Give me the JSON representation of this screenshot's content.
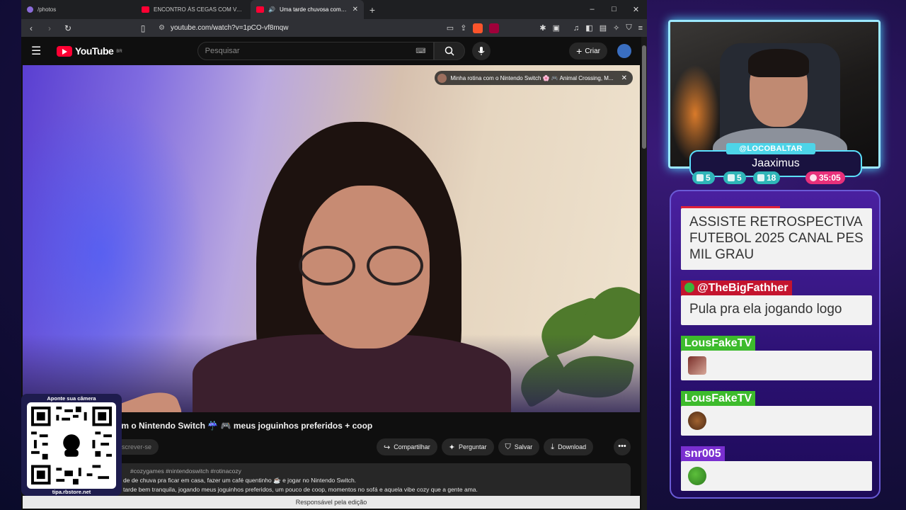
{
  "browser": {
    "tabs": [
      {
        "label": "/photos",
        "active": false
      },
      {
        "label": "ENCONTRO ÀS CEGAS COM VALENTINA BA",
        "active": false
      },
      {
        "label": "Uma tarde chuvosa com o Nintendo",
        "active": true
      }
    ],
    "url": "youtube.com/watch?v=1pCO-vf8mqw",
    "window_controls": [
      "–",
      "□",
      "✕"
    ],
    "brave_badge": "1"
  },
  "youtube": {
    "logo": "YouTube",
    "region": "BR",
    "search_placeholder": "Pesquisar",
    "create_label": "Criar",
    "overlay_chip": "Minha rotina com o Nintendo Switch 🌸 🎮 Animal Crossing, M...",
    "video_title": "om o Nintendo Switch ☔ 🎮 meus joguinhos preferidos + coop",
    "subscribe_label": "screver-se",
    "actions": [
      {
        "icon": "share-icon",
        "label": "Compartilhar"
      },
      {
        "icon": "sparkle-icon",
        "label": "Perguntar"
      },
      {
        "icon": "bookmark-icon",
        "label": "Salvar"
      },
      {
        "icon": "download-icon",
        "label": "Download"
      }
    ],
    "description": {
      "tags": "#cozygames #nintendoswitch #rotinacozy",
      "line1": "de de chuva pra ficar em casa, fazer um café quentinho ☕ e jogar no Nintendo Switch.",
      "line2": "tarde bem tranquila, jogando meus joguinhos preferidos, um pouco de coop, momentos no sofá e aquela vibe cozy que a gente ama."
    },
    "footer": "Responsável pela edição"
  },
  "qr": {
    "title": "Aponte sua câmera",
    "footer": "tipa.rbstore.net"
  },
  "overlay": {
    "handle": "@LOCOBALTAR",
    "name": "Jaaximus",
    "stats": [
      {
        "icon": "twitch-icon",
        "value": "5",
        "color": "#2fb5b8"
      },
      {
        "icon": "youtube-icon",
        "value": "5",
        "color": "#2fb5b8"
      },
      {
        "icon": "kick-icon",
        "value": "18",
        "color": "#2fb5b8"
      },
      {
        "icon": "timer-icon",
        "value": "35:05",
        "color": "#e8307a"
      }
    ]
  },
  "chat": [
    {
      "user": "",
      "text": "ASSISTE RETROSPECTIVA FUTEBOL 2025 CANAL PES MIL GRAU",
      "tag_color": "#e0213a"
    },
    {
      "user": "@TheBigFathher",
      "text": "Pula pra ela jogando logo",
      "tag_color": "#c4142e"
    },
    {
      "user": "LousFakeTV",
      "text": "",
      "tag_color": "#3dbb2c",
      "emote": "face-emote"
    },
    {
      "user": "LousFakeTV",
      "text": "",
      "tag_color": "#3dbb2c",
      "emote": "face-emote"
    },
    {
      "user": "snr005",
      "text": "",
      "tag_color": "#7a2fd0",
      "emote": "frog-emote"
    }
  ]
}
